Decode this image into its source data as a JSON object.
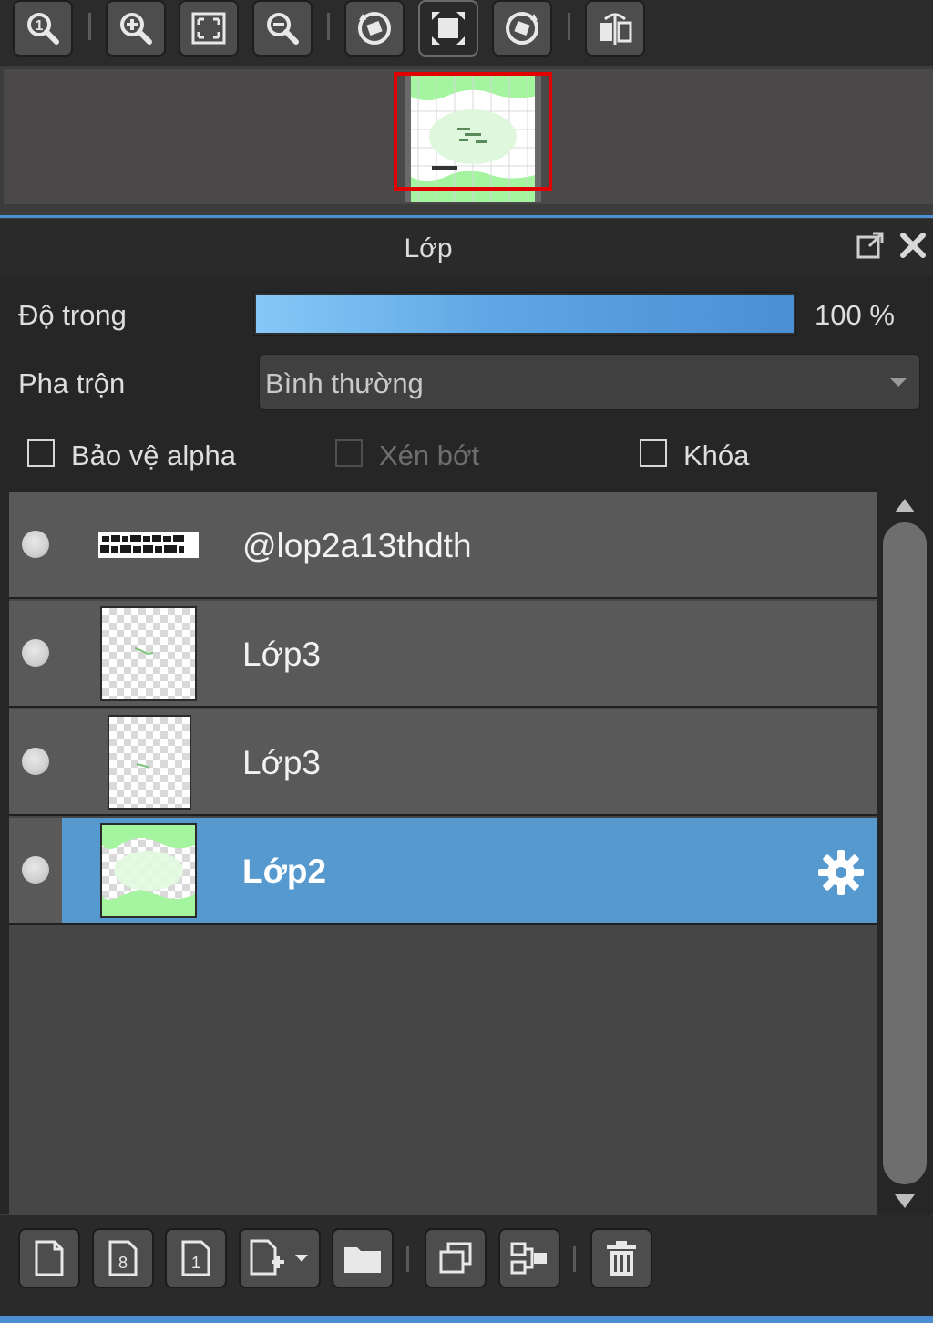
{
  "toolbar": {
    "buttons": [
      {
        "name": "zoom-100-icon",
        "pressed": false
      },
      {
        "name": "zoom-in-icon",
        "pressed": false
      },
      {
        "name": "fit-window-icon",
        "pressed": false
      },
      {
        "name": "zoom-out-icon",
        "pressed": false
      },
      {
        "name": "rotate-left-icon",
        "pressed": false
      },
      {
        "name": "reset-view-icon",
        "pressed": true
      },
      {
        "name": "rotate-right-icon",
        "pressed": false
      },
      {
        "name": "flip-horizontal-icon",
        "pressed": false
      }
    ]
  },
  "panel": {
    "title": "Lớp",
    "popout_icon": "popout-icon",
    "close_icon": "close-icon"
  },
  "opacity": {
    "label": "Độ trong",
    "value_text": "100 %",
    "fraction": 1.0,
    "gradient_start": "#86c8f7",
    "gradient_end": "#4a8fd3"
  },
  "blend": {
    "label": "Pha trộn",
    "selected": "Bình thường"
  },
  "checkboxes": {
    "protect_alpha": {
      "label": "Bảo vệ alpha",
      "checked": false,
      "enabled": true
    },
    "clipping": {
      "label": "Xén bớt",
      "checked": false,
      "enabled": false
    },
    "lock": {
      "label": "Khóa",
      "checked": false,
      "enabled": true
    }
  },
  "layers": [
    {
      "name": "@lop2a13thdth",
      "visible": true,
      "selected": false,
      "thumb": "text"
    },
    {
      "name": "Lớp3",
      "visible": true,
      "selected": false,
      "thumb": "transparent"
    },
    {
      "name": "Lớp3",
      "visible": true,
      "selected": false,
      "thumb": "transparent-narrow"
    },
    {
      "name": "Lớp2",
      "visible": true,
      "selected": true,
      "thumb": "green-frame",
      "settings_icon": "gear-icon"
    }
  ],
  "bottom_toolbar": {
    "buttons": [
      "new-layer-icon",
      "new-8bit-layer-icon",
      "new-1bit-layer-icon",
      "add-layer-menu-icon",
      "new-folder-icon",
      "duplicate-layer-icon",
      "merge-down-icon",
      "delete-layer-icon"
    ]
  },
  "colors": {
    "accent": "#4b8fd0",
    "selected_row": "#5599cf",
    "selection_frame": "#e00000",
    "canvas_green": "#a5f5a0"
  }
}
